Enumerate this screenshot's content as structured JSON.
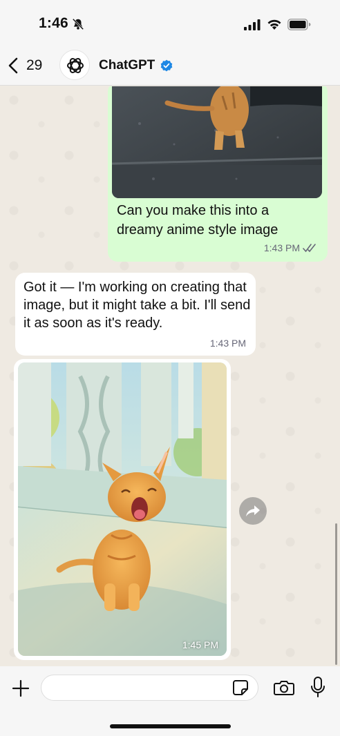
{
  "status": {
    "time": "1:46"
  },
  "header": {
    "back_count": "29",
    "contact_name": "ChatGPT"
  },
  "messages": {
    "outgoing": {
      "text": "Can you make this into a dreamy anime style image",
      "time": "1:43 PM"
    },
    "incoming": {
      "text": "Got it — I'm working on creating that image, but it might take a bit. I'll send it as soon as it's ready.",
      "time": "1:43 PM"
    },
    "image": {
      "time": "1:45 PM"
    }
  },
  "input": {
    "placeholder": ""
  },
  "colors": {
    "outgoing_bubble": "#d9fdd3",
    "verified_badge": "#1e88e5",
    "chat_background": "#efeae2"
  },
  "icons": [
    "bell-off-icon",
    "signal-icon",
    "wifi-icon",
    "battery-icon",
    "back-chevron-icon",
    "openai-logo",
    "verified-icon",
    "double-check-icon",
    "forward-icon",
    "plus-icon",
    "sticker-icon",
    "camera-icon",
    "microphone-icon"
  ]
}
